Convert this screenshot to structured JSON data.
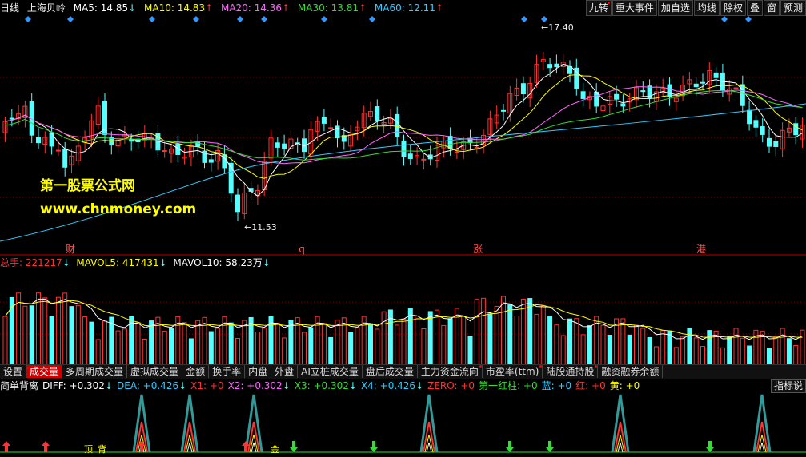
{
  "legend": {
    "period": "日线",
    "stock_name": "上海贝岭",
    "ma5": {
      "label": "MA5:",
      "value": "14.85",
      "arrow": "↓",
      "color": "#ffffff"
    },
    "ma10": {
      "label": "MA10:",
      "value": "14.83",
      "arrow": "↑",
      "color": "#ffff00"
    },
    "ma20": {
      "label": "MA20:",
      "value": "14.36",
      "arrow": "↑",
      "color": "#ff66ff"
    },
    "ma30": {
      "label": "MA30:",
      "value": "13.81",
      "arrow": "↑",
      "color": "#33dd33"
    },
    "ma60": {
      "label": "MA60:",
      "value": "12.11",
      "arrow": "↑",
      "color": "#33ccff"
    }
  },
  "toolbar": [
    "九转",
    "重大事件",
    "加自选",
    "均线",
    "除权",
    "叠",
    "窗",
    "预测"
  ],
  "price_chart": {
    "high_label": "17.40",
    "low_label": "11.53",
    "event_markers": [
      "财",
      "q",
      "涨",
      "港"
    ],
    "watermark_title": "第一股票公式网",
    "watermark_url": "www.chnmoney.com"
  },
  "volume": {
    "total_label": "总手:",
    "total_value": "221217",
    "total_arrow": "↓",
    "mavol5_label": "MAVOL5:",
    "mavol5_value": "417431",
    "mavol5_arrow": "↓",
    "mavol10_label": "MAVOL10:",
    "mavol10_value": "58.23万",
    "mavol10_arrow": "↓"
  },
  "tabs": [
    {
      "label": "设置",
      "active": false,
      "dot": false
    },
    {
      "label": "成交量",
      "active": true,
      "dot": false
    },
    {
      "label": "多周期成交量",
      "active": false,
      "dot": false
    },
    {
      "label": "虚拟成交量",
      "active": false,
      "dot": false
    },
    {
      "label": "金额",
      "active": false,
      "dot": false
    },
    {
      "label": "换手率",
      "active": false,
      "dot": false
    },
    {
      "label": "内盘",
      "active": false,
      "dot": false
    },
    {
      "label": "外盘",
      "active": false,
      "dot": false
    },
    {
      "label": "AI立桩成交量",
      "active": false,
      "dot": false
    },
    {
      "label": "盘后成交量",
      "active": false,
      "dot": false
    },
    {
      "label": "主力资金流向",
      "active": false,
      "dot": true
    },
    {
      "label": "市盈率(ttm)",
      "active": false,
      "dot": true
    },
    {
      "label": "陆股通持股",
      "active": false,
      "dot": true
    },
    {
      "label": "融资融券余额",
      "active": false,
      "dot": false
    }
  ],
  "indicator": {
    "name": "简单背离",
    "items": [
      {
        "label": "DIFF:",
        "value": "+0.302",
        "arrow": "↓",
        "color": "#ffffff"
      },
      {
        "label": "DEA:",
        "value": "+0.426",
        "arrow": "↓",
        "color": "#33ccff"
      },
      {
        "label": "X1:",
        "value": "+0",
        "arrow": "",
        "color": "#ff3333"
      },
      {
        "label": "X2:",
        "value": "+0.302",
        "arrow": "↓",
        "color": "#ff66ff"
      },
      {
        "label": "X3:",
        "value": "+0.302",
        "arrow": "↓",
        "color": "#33dd33"
      },
      {
        "label": "X4:",
        "value": "+0.426",
        "arrow": "↓",
        "color": "#33ccff"
      },
      {
        "label": "ZERO:",
        "value": "+0",
        "arrow": "",
        "color": "#ff3333"
      },
      {
        "label": "第一红柱:",
        "value": "+0",
        "arrow": "",
        "color": "#33dd33"
      },
      {
        "label": "蓝:",
        "value": "+0",
        "arrow": "",
        "color": "#33ccff"
      },
      {
        "label": "红:",
        "value": "+0",
        "arrow": "",
        "color": "#ff3333"
      },
      {
        "label": "黄:",
        "value": "+0",
        "arrow": "",
        "color": "#ffff00"
      }
    ],
    "button": "指标说",
    "bottom_labels": [
      "顶",
      "背",
      "金"
    ]
  },
  "colors": {
    "up": "#ff3333",
    "down": "#55ffff",
    "grid": "#7a0000"
  }
}
